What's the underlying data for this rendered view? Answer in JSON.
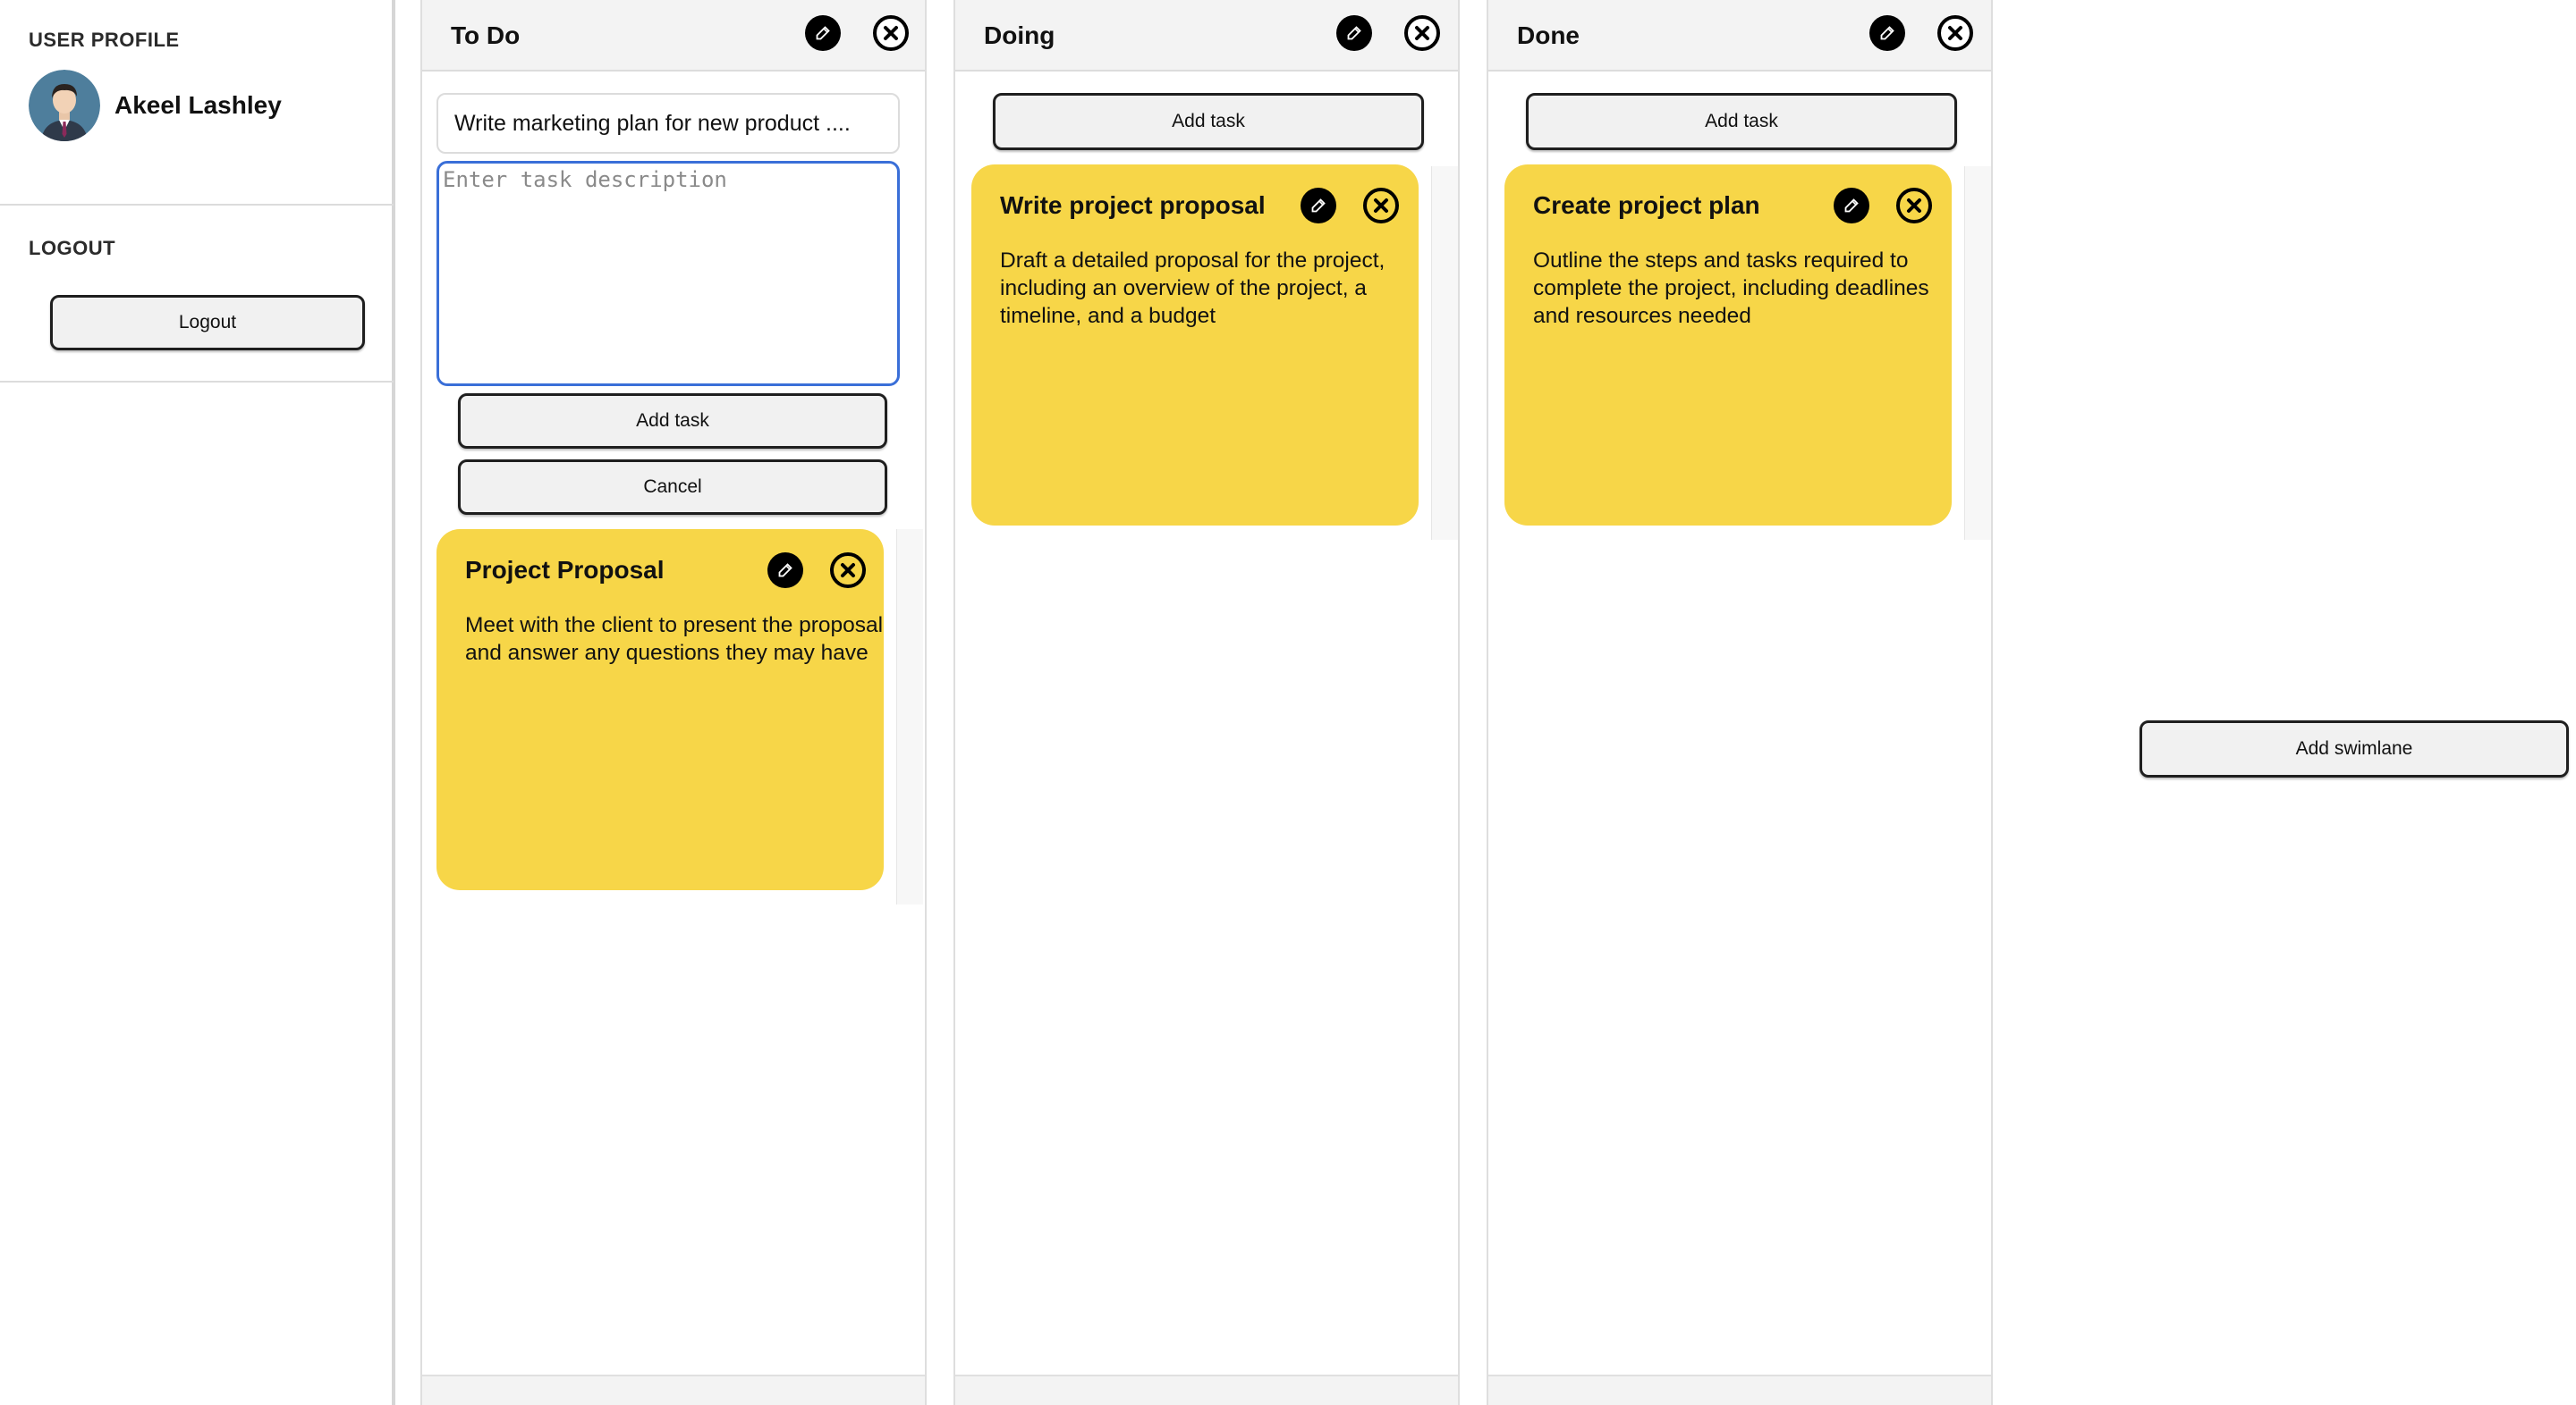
{
  "sidebar": {
    "profile_heading": "USER PROFILE",
    "user_name": "Akeel Lashley",
    "logout_heading": "LOGOUT",
    "logout_button": "Logout"
  },
  "board": {
    "lanes": [
      {
        "title": "To Do",
        "new_task": {
          "title_value": "Write marketing plan for new product ....",
          "description_placeholder": "Enter task description",
          "add_button": "Add task",
          "cancel_button": "Cancel"
        },
        "cards": [
          {
            "title": "Project Proposal",
            "description": "Meet with the client to present the proposal and answer any questions they may have"
          }
        ]
      },
      {
        "title": "Doing",
        "add_button": "Add task",
        "cards": [
          {
            "title": "Write project proposal",
            "description": "Draft a detailed proposal for the project, including an overview of the project, a timeline, and a budget"
          }
        ]
      },
      {
        "title": "Done",
        "add_button": "Add task",
        "cards": [
          {
            "title": "Create project plan",
            "description": "Outline the steps and tasks required to complete the project, including deadlines and resources needed"
          }
        ]
      }
    ],
    "add_swimlane_button": "Add swimlane"
  },
  "colors": {
    "card": "#f7d648",
    "focus_border": "#3a6fd8",
    "header_bg": "#f3f3f3"
  },
  "icons": [
    "pencil-icon",
    "close-circle-icon"
  ]
}
